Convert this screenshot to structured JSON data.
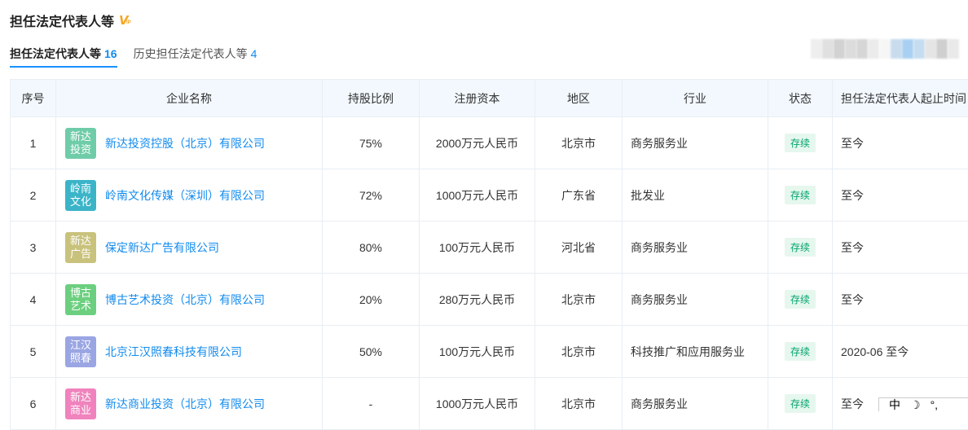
{
  "section": {
    "title": "担任法定代表人等"
  },
  "tabs": [
    {
      "label": "担任法定代表人等",
      "count": "16"
    },
    {
      "label": "历史担任法定代表人等",
      "count": "4"
    }
  ],
  "table": {
    "headers": [
      "序号",
      "企业名称",
      "持股比例",
      "注册资本",
      "地区",
      "行业",
      "状态",
      "担任法定代表人起止时间"
    ],
    "rows": [
      {
        "index": "1",
        "logo_text": "新达\n投资",
        "logo_color": "#6fcca8",
        "name": "新达投资控股（北京）有限公司",
        "ratio": "75%",
        "capital": "2000万元人民币",
        "region": "北京市",
        "industry": "商务服务业",
        "status": "存续",
        "period": "至今"
      },
      {
        "index": "2",
        "logo_text": "岭南\n文化",
        "logo_color": "#3bb4c8",
        "name": "岭南文化传媒（深圳）有限公司",
        "ratio": "72%",
        "capital": "1000万元人民币",
        "region": "广东省",
        "industry": "批发业",
        "status": "存续",
        "period": "至今"
      },
      {
        "index": "3",
        "logo_text": "新达\n广告",
        "logo_color": "#c9c27c",
        "name": "保定新达广告有限公司",
        "ratio": "80%",
        "capital": "100万元人民币",
        "region": "河北省",
        "industry": "商务服务业",
        "status": "存续",
        "period": "至今"
      },
      {
        "index": "4",
        "logo_text": "博古\n艺术",
        "logo_color": "#6ccf7f",
        "name": "博古艺术投资（北京）有限公司",
        "ratio": "20%",
        "capital": "280万元人民币",
        "region": "北京市",
        "industry": "商务服务业",
        "status": "存续",
        "period": "至今"
      },
      {
        "index": "5",
        "logo_text": "江汉\n照春",
        "logo_color": "#9aa6e3",
        "name": "北京江汉照春科技有限公司",
        "ratio": "50%",
        "capital": "100万元人民币",
        "region": "北京市",
        "industry": "科技推广和应用服务业",
        "status": "存续",
        "period": "2020-06 至今"
      },
      {
        "index": "6",
        "logo_text": "新达\n商业",
        "logo_color": "#f083bd",
        "name": "新达商业投资（北京）有限公司",
        "ratio": "-",
        "capital": "1000万元人民币",
        "region": "北京市",
        "industry": "商务服务业",
        "status": "存续",
        "period": "至今"
      }
    ]
  },
  "ime": {
    "lang": "中",
    "moon": "☽",
    "dots": "°,"
  },
  "colors": {
    "accent": "#128bed",
    "status_bg": "#e6f7ee",
    "status_text": "#00a46b",
    "header_bg": "#f2f8fd"
  },
  "icons": {
    "vip": "vip-icon"
  }
}
